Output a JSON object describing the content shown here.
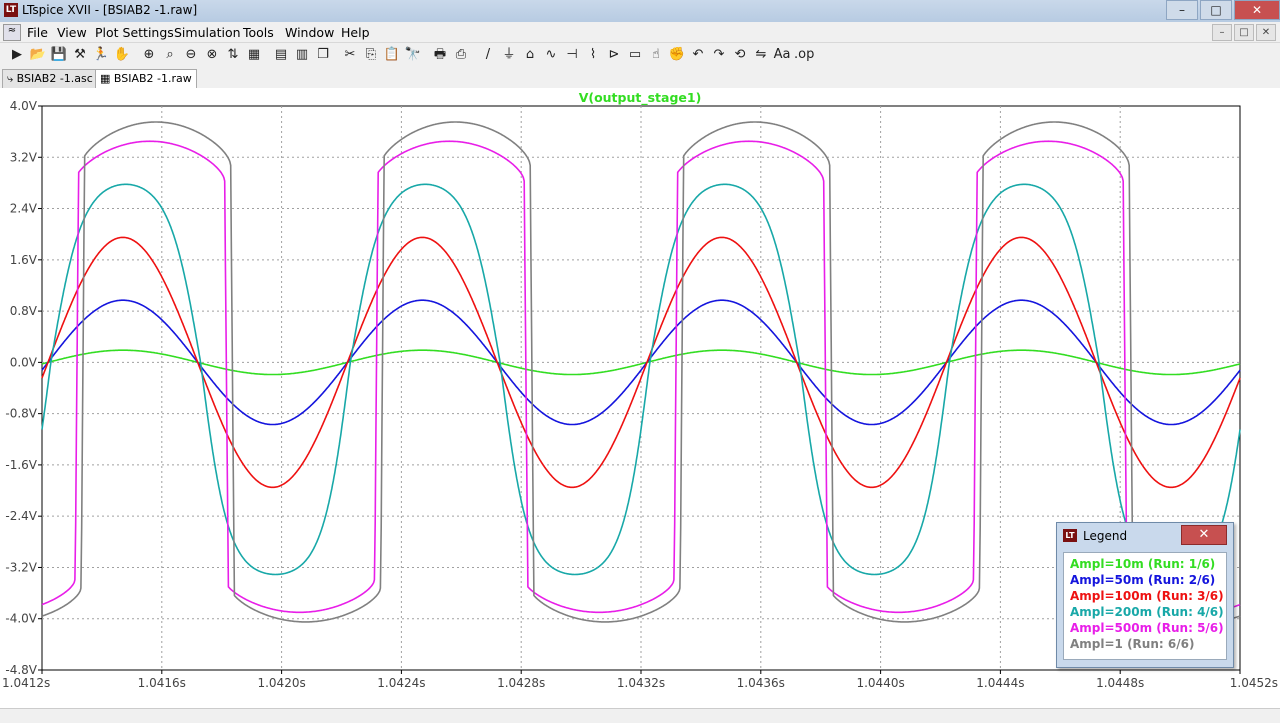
{
  "window": {
    "title": "LTspice XVII - [BSIAB2 -1.raw]",
    "app_icon_text": "LT"
  },
  "menu": [
    "File",
    "View",
    "Plot Settings",
    "Simulation",
    "Tools",
    "Window",
    "Help"
  ],
  "toolbar_icons": [
    "run-icon",
    "open-icon",
    "save-icon",
    "hammer-icon",
    "run-man-icon",
    "pan-icon",
    "zoom-in-icon",
    "zoom-area-icon",
    "zoom-out-icon",
    "zoom-cancel-icon",
    "autorange-icon",
    "grid-icon",
    "tile-horizontal-icon",
    "tile-vertical-icon",
    "cascade-icon",
    "cut-icon",
    "copy-icon",
    "paste-icon",
    "find-icon",
    "print-icon",
    "print-setup-icon",
    "wire-icon",
    "ground-icon",
    "label-icon",
    "resistor-icon",
    "capacitor-icon",
    "inductor-icon",
    "diode-icon",
    "component-icon",
    "move-icon",
    "drag-icon",
    "undo-icon",
    "redo-icon",
    "rotate-icon",
    "mirror-icon",
    "text-icon",
    "spice-directive-icon"
  ],
  "tabs": [
    {
      "label": "BSIAB2 -1.asc",
      "icon": "schematic-icon",
      "active": false
    },
    {
      "label": "BSIAB2 -1.raw",
      "icon": "waveform-icon",
      "active": true
    }
  ],
  "legend": {
    "title": "Legend",
    "entries": [
      {
        "text": "Ampl=10m  (Run: 1/6)",
        "color": "#33dd22"
      },
      {
        "text": "Ampl=50m  (Run: 2/6)",
        "color": "#1515dd"
      },
      {
        "text": "Ampl=100m  (Run: 3/6)",
        "color": "#ee1111"
      },
      {
        "text": "Ampl=200m  (Run: 4/6)",
        "color": "#18a8a8"
      },
      {
        "text": "Ampl=500m  (Run: 5/6)",
        "color": "#e81ee8"
      },
      {
        "text": "Ampl=1  (Run: 6/6)",
        "color": "#808080"
      }
    ]
  },
  "chart_data": {
    "type": "line",
    "title": "V(output_stage1)",
    "title_color": "#33dd22",
    "xlim": [
      1.0412,
      1.0452
    ],
    "ylim": [
      -4.8,
      4.0
    ],
    "x_ticks": [
      "1.0412s",
      "1.0416s",
      "1.0420s",
      "1.0424s",
      "1.0428s",
      "1.0432s",
      "1.0436s",
      "1.0440s",
      "1.0444s",
      "1.0448s",
      "1.0452s"
    ],
    "y_ticks": [
      "4.0V",
      "3.2V",
      "2.4V",
      "1.6V",
      "0.8V",
      "0.0V",
      "-0.8V",
      "-1.6V",
      "-2.4V",
      "-3.2V",
      "-4.0V",
      "-4.8V"
    ],
    "grid": true,
    "period_s": 0.001,
    "zero_crossing_up_s": 1.04122,
    "series": [
      {
        "name": "Ampl=10m",
        "color": "#33dd22",
        "peak_pos": 0.19,
        "peak_neg": -0.19,
        "shape": "sine"
      },
      {
        "name": "Ampl=50m",
        "color": "#1515dd",
        "peak_pos": 0.97,
        "peak_neg": -0.97,
        "shape": "sine"
      },
      {
        "name": "Ampl=100m",
        "color": "#ee1111",
        "peak_pos": 1.95,
        "peak_neg": -1.95,
        "shape": "sine"
      },
      {
        "name": "Ampl=200m",
        "color": "#18a8a8",
        "peak_pos": 3.0,
        "peak_neg": -3.5,
        "shape": "clipped"
      },
      {
        "name": "Ampl=500m",
        "color": "#e81ee8",
        "peak_pos": 3.45,
        "peak_neg": -3.9,
        "shape": "square"
      },
      {
        "name": "Ampl=1",
        "color": "#808080",
        "peak_pos": 3.75,
        "peak_neg": -4.05,
        "shape": "square"
      }
    ]
  }
}
